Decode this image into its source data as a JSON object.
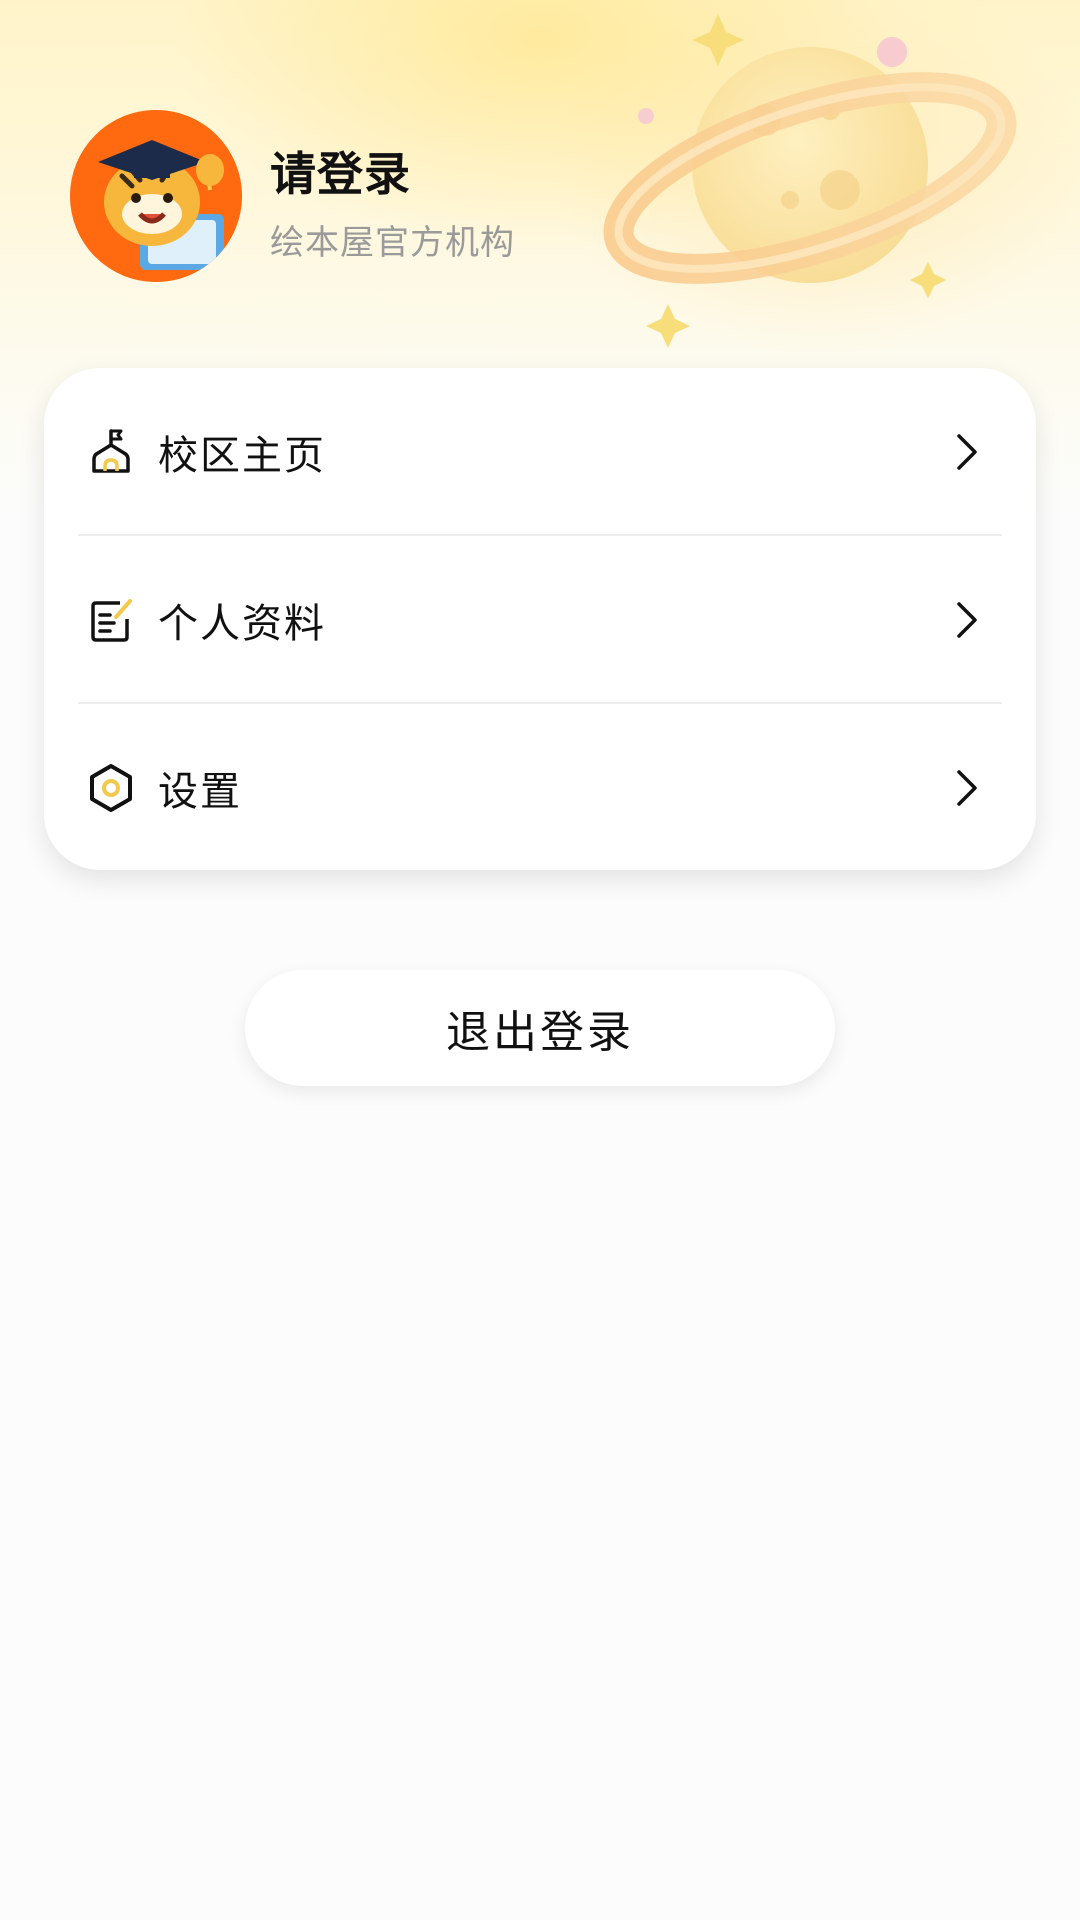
{
  "profile": {
    "name": "请登录",
    "organization": "绘本屋官方机构",
    "avatar_icon": "tiger-mascot-avatar",
    "avatar_color": "#ff6a10"
  },
  "menu": {
    "items": [
      {
        "label": "校区主页",
        "icon": "campus-icon"
      },
      {
        "label": "个人资料",
        "icon": "profile-doc-icon"
      },
      {
        "label": "设置",
        "icon": "settings-hexagon-icon"
      }
    ]
  },
  "logout": {
    "label": "退出登录"
  },
  "colors": {
    "accent_yellow": "#f2c94c",
    "header_bg": "#fff4c9",
    "text_primary": "#111111",
    "text_secondary": "#9a9a9a"
  }
}
